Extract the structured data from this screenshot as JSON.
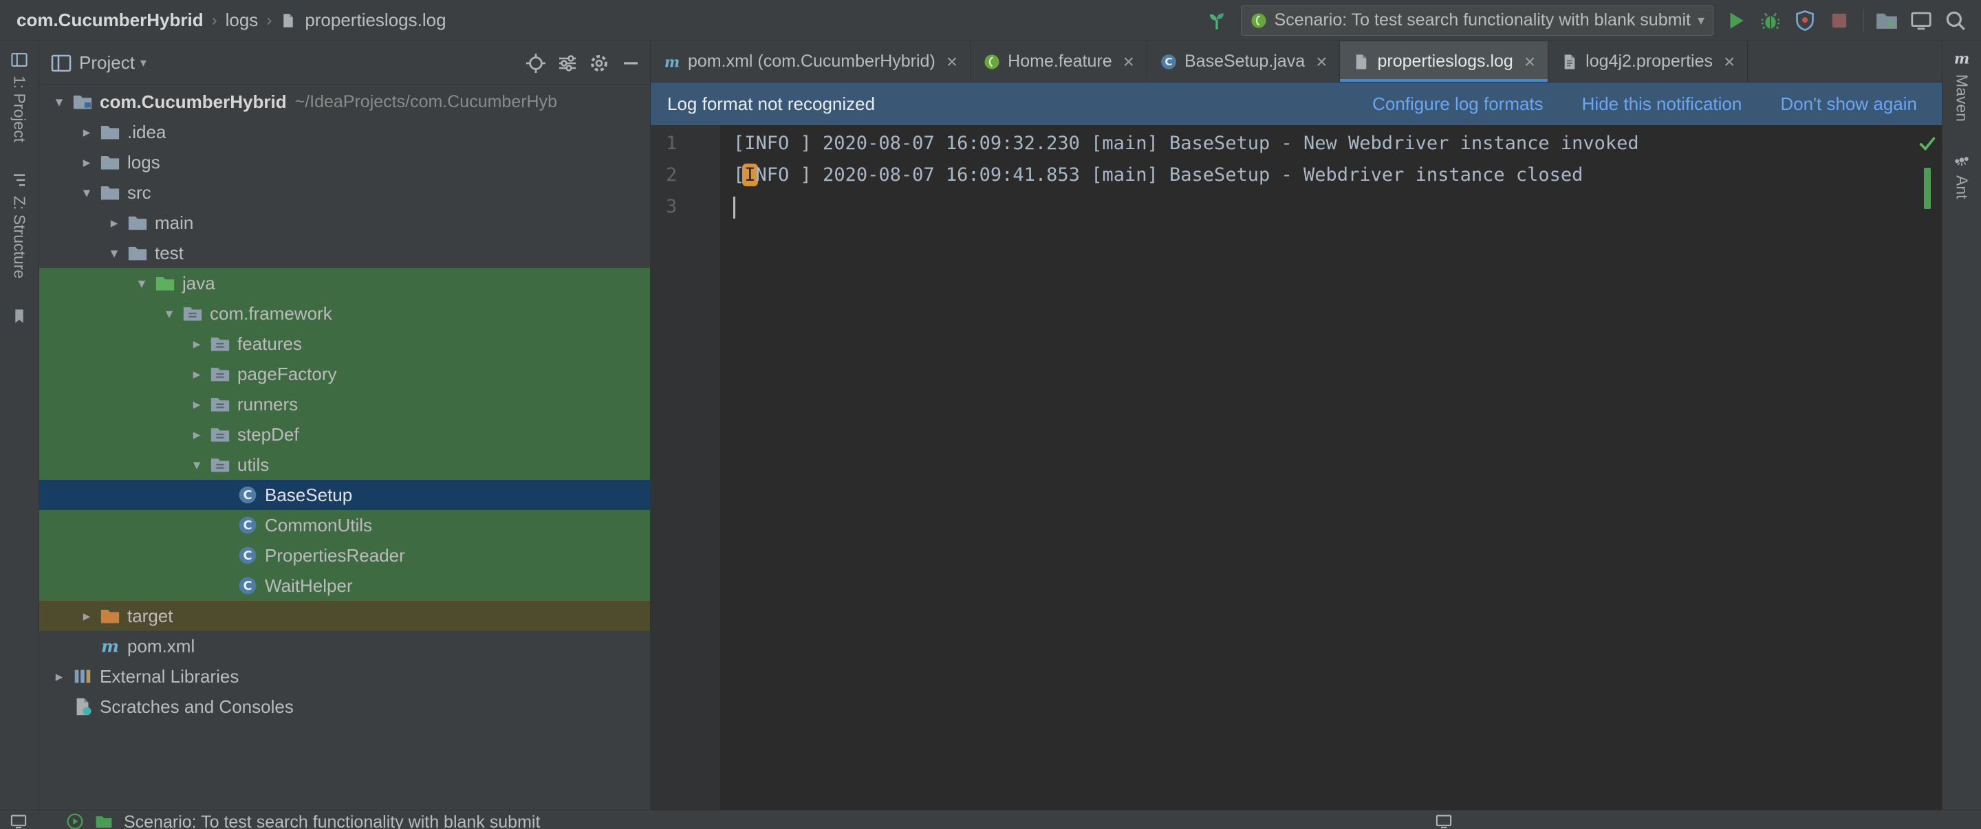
{
  "colors": {
    "panel_bg": "#3c3f41",
    "editor_bg": "#2b2b2b",
    "selection_blue": "#173d63",
    "selection_green": "#3f6b43",
    "excluded_olive": "#4f4b2d",
    "link_blue": "#6ba6f2",
    "banner_bg": "#3a5876",
    "run_green": "#499c54",
    "bookmark_orange": "#d79440"
  },
  "top_bar": {
    "breadcrumbs": [
      "com.CucumberHybrid",
      "logs",
      "propertieslogs.log"
    ],
    "run_config": "Scenario: To test search functionality with blank submit"
  },
  "left_stripe": {
    "items": [
      {
        "label": "1: Project"
      },
      {
        "label": "Z: Structure"
      }
    ]
  },
  "right_stripe": {
    "items": [
      {
        "label": "Maven"
      },
      {
        "label": "Ant"
      }
    ]
  },
  "project_panel": {
    "title": "Project",
    "tree": [
      {
        "label": "com.CucumberHybrid",
        "suffix": "~/IdeaProjects/com.CucumberHyb",
        "level": 0,
        "icon": "module",
        "chevron": "open",
        "bg": "none",
        "bold": true
      },
      {
        "label": ".idea",
        "level": 1,
        "icon": "folder",
        "chevron": "closed",
        "bg": "none"
      },
      {
        "label": "logs",
        "level": 1,
        "icon": "folder",
        "chevron": "closed",
        "bg": "none"
      },
      {
        "label": "src",
        "level": 1,
        "icon": "folder",
        "chevron": "open",
        "bg": "none"
      },
      {
        "label": "main",
        "level": 2,
        "icon": "folder",
        "chevron": "closed",
        "bg": "none"
      },
      {
        "label": "test",
        "level": 2,
        "icon": "folder",
        "chevron": "open",
        "bg": "none"
      },
      {
        "label": "java",
        "level": 3,
        "icon": "folder-green",
        "chevron": "open",
        "bg": "green"
      },
      {
        "label": "com.framework",
        "level": 4,
        "icon": "package",
        "chevron": "open",
        "bg": "green"
      },
      {
        "label": "features",
        "level": 5,
        "icon": "package",
        "chevron": "closed",
        "bg": "green"
      },
      {
        "label": "pageFactory",
        "level": 5,
        "icon": "package",
        "chevron": "closed",
        "bg": "green"
      },
      {
        "label": "runners",
        "level": 5,
        "icon": "package",
        "chevron": "closed",
        "bg": "green"
      },
      {
        "label": "stepDef",
        "level": 5,
        "icon": "package",
        "chevron": "closed",
        "bg": "green"
      },
      {
        "label": "utils",
        "level": 5,
        "icon": "package",
        "chevron": "open",
        "bg": "green"
      },
      {
        "label": "BaseSetup",
        "level": 6,
        "icon": "class",
        "chevron": "none",
        "bg": "blue"
      },
      {
        "label": "CommonUtils",
        "level": 6,
        "icon": "class",
        "chevron": "none",
        "bg": "green"
      },
      {
        "label": "PropertiesReader",
        "level": 6,
        "icon": "class",
        "chevron": "none",
        "bg": "green"
      },
      {
        "label": "WaitHelper",
        "level": 6,
        "icon": "class",
        "chevron": "none",
        "bg": "green"
      },
      {
        "label": "target",
        "level": 1,
        "icon": "folder-orange",
        "chevron": "closed",
        "bg": "olive"
      },
      {
        "label": "pom.xml",
        "level": 1,
        "icon": "maven",
        "chevron": "none",
        "bg": "none"
      },
      {
        "label": "External Libraries",
        "level": 0,
        "icon": "library",
        "chevron": "closed",
        "bg": "none"
      },
      {
        "label": "Scratches and Consoles",
        "level": 0,
        "icon": "scratches",
        "chevron": "none",
        "bg": "none"
      }
    ]
  },
  "editor": {
    "tabs": [
      {
        "label": "pom.xml (com.CucumberHybrid)",
        "icon": "maven",
        "selected": false
      },
      {
        "label": "Home.feature",
        "icon": "cucumber",
        "selected": false
      },
      {
        "label": "BaseSetup.java",
        "icon": "class",
        "selected": false
      },
      {
        "label": "propertieslogs.log",
        "icon": "file",
        "selected": true
      },
      {
        "label": "log4j2.properties",
        "icon": "properties",
        "selected": false
      }
    ],
    "notification": {
      "message": "Log format not recognized",
      "actions": [
        "Configure log formats",
        "Hide this notification",
        "Don't show again"
      ]
    },
    "lines": [
      {
        "num": "1",
        "text": "[INFO ] 2020-08-07 16:09:32.230 [main] BaseSetup - New Webdriver instance invoked"
      },
      {
        "num": "2",
        "text": "[INFO ] 2020-08-07 16:09:41.853 [main] BaseSetup - Webdriver instance closed",
        "badge_start": 1,
        "badge_len": 1
      },
      {
        "num": "3",
        "text": "",
        "caret": true
      }
    ]
  },
  "bottom_bar": {
    "run_label": "Scenario: To test search functionality with blank submit"
  }
}
